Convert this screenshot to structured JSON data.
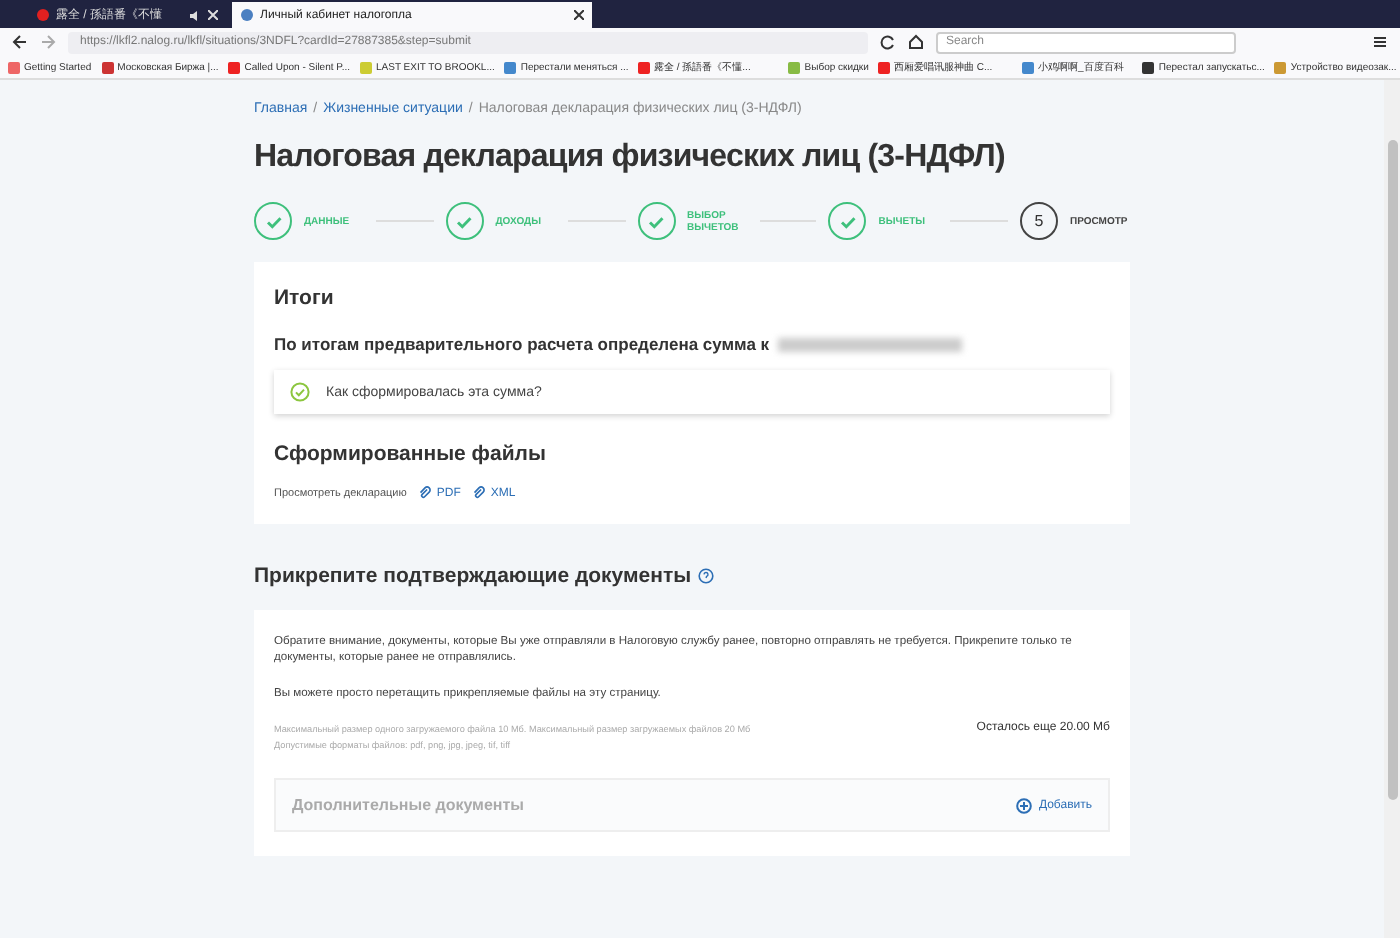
{
  "browser": {
    "tabs": [
      {
        "title": "露全 / 孫語番《不懂",
        "selected": false,
        "audio": true
      },
      {
        "title": "Личный кабинет налогопла",
        "selected": true,
        "audio": false
      }
    ],
    "url": "https://lkfl2.nalog.ru/lkfl/situations/3NDFL?cardId=27887385&step=submit",
    "search_placeholder": "Search",
    "bookmarks": [
      "Getting Started",
      "Московская Биржа |...",
      "Called Upon - Silent P...",
      "LAST EXIT TO BROOKL...",
      "Перестали меняться ...",
      "露全 / 孫語番《不懂...",
      "Выбор скидки",
      "西厢爱唱讯服神曲 C...",
      "小鸡啊啊_百度百科",
      "Перестал запускатьс...",
      "Устройство видеозак..."
    ]
  },
  "breadcrumbs": {
    "separator": "/",
    "items": [
      {
        "label": "Главная",
        "link": true
      },
      {
        "label": "Жизненные ситуации",
        "link": true
      },
      {
        "label": "Налоговая декларация физических лиц (3-НДФЛ)",
        "link": false
      }
    ]
  },
  "title": "Налоговая декларация физических лиц (3-НДФЛ)",
  "steps": [
    {
      "label": "ДАННЫЕ",
      "done": true
    },
    {
      "label": "ДОХОДЫ",
      "done": true
    },
    {
      "label": "ВЫБОР ВЫЧЕТОВ",
      "done": true
    },
    {
      "label": "ВЫЧЕТЫ",
      "done": true
    },
    {
      "label": "ПРОСМОТР",
      "done": false,
      "number": "5"
    }
  ],
  "summary": {
    "heading": "Итоги",
    "result": "По итогам предварительного расчета определена сумма к",
    "question": "Как сформировалась эта сумма?",
    "files_heading": "Сформированные файлы",
    "files_label": "Просмотреть декларацию",
    "files": [
      "PDF",
      "XML"
    ]
  },
  "attach": {
    "heading": "Прикрепите подтверждающие документы",
    "notice": "Обратите внимание, документы, которые Вы уже отправляли в Налоговую службу ранее, повторно отправлять не требуется. Прикрепите только те документы, которые ранее не отправлялись.",
    "drag_hint": "Вы можете просто перетащить прикрепляемые файлы на эту страницу.",
    "limits": "Максимальный размер одного загружаемого файла 10 Мб. Максимальный размер загружаемых файлов 20 Мб",
    "formats": "Допустимые форматы файлов: pdf, png, jpg, jpeg, tif, tiff",
    "remaining": "Осталось еще 20.00 Мб",
    "section": "Дополнительные документы",
    "add": "Добавить"
  }
}
